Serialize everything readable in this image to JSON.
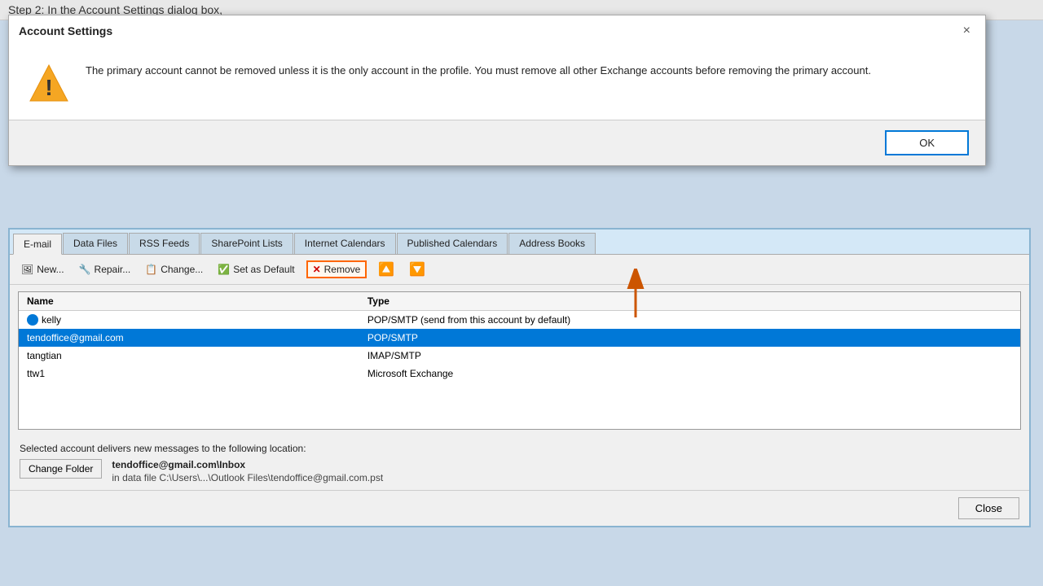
{
  "background_text": "Step 2: In the Account Settings dialog box,",
  "warning_dialog": {
    "title": "Account Settings",
    "close_label": "×",
    "message": "The primary account cannot be removed unless it is the only account in the profile. You must remove all other Exchange accounts before removing the primary account.",
    "ok_label": "OK"
  },
  "account_settings": {
    "tabs": [
      {
        "label": "E-mail",
        "active": true
      },
      {
        "label": "Data Files",
        "active": false
      },
      {
        "label": "RSS Feeds",
        "active": false
      },
      {
        "label": "SharePoint Lists",
        "active": false
      },
      {
        "label": "Internet Calendars",
        "active": false
      },
      {
        "label": "Published Calendars",
        "active": false
      },
      {
        "label": "Address Books",
        "active": false
      }
    ],
    "toolbar": {
      "new_label": "New...",
      "repair_label": "Repair...",
      "change_label": "Change...",
      "set_default_label": "Set as Default",
      "remove_label": "Remove"
    },
    "table": {
      "headers": [
        "Name",
        "Type"
      ],
      "rows": [
        {
          "name": "kelly",
          "type": "POP/SMTP (send from this account by default)",
          "is_default": true,
          "selected": false
        },
        {
          "name": "tendoffice@gmail.com",
          "type": "POP/SMTP",
          "is_default": false,
          "selected": true
        },
        {
          "name": "tangtian",
          "type": "IMAP/SMTP",
          "is_default": false,
          "selected": false
        },
        {
          "name": "ttw1",
          "type": "Microsoft Exchange",
          "is_default": false,
          "selected": false
        }
      ]
    },
    "footer": {
      "delivers_label": "Selected account delivers new messages to the following location:",
      "change_folder_label": "Change Folder",
      "folder_name": "tendoffice@gmail.com\\Inbox",
      "folder_path": "in data file C:\\Users\\...\\Outlook Files\\tendoffice@gmail.com.pst"
    },
    "close_label": "Close"
  }
}
